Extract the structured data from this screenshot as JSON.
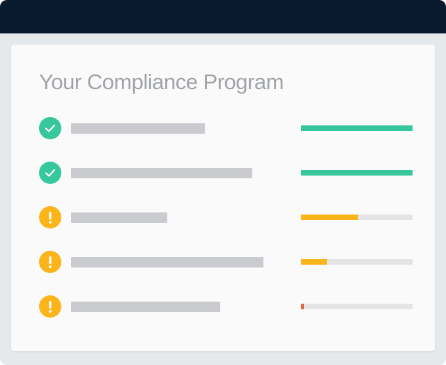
{
  "window": {
    "titlebar_color": "#0a1a2e"
  },
  "card": {
    "title": "Your Compliance Program"
  },
  "colors": {
    "complete": "#36c79c",
    "warning": "#fbb41a",
    "critical": "#e3663b",
    "track": "#e3e4e6",
    "placeholder": "#c9cbce"
  },
  "items": [
    {
      "status": "complete",
      "icon": "checkmark-icon",
      "progress": 1.0,
      "progress_color": "#36c79c"
    },
    {
      "status": "complete",
      "icon": "checkmark-icon",
      "progress": 1.0,
      "progress_color": "#36c79c"
    },
    {
      "status": "warning",
      "icon": "exclamation-icon",
      "progress": 0.51,
      "progress_color": "#fbb41a"
    },
    {
      "status": "warning",
      "icon": "exclamation-icon",
      "progress": 0.23,
      "progress_color": "#fbb41a"
    },
    {
      "status": "warning",
      "icon": "exclamation-icon",
      "progress": 0.025,
      "progress_color": "#e3663b"
    }
  ]
}
